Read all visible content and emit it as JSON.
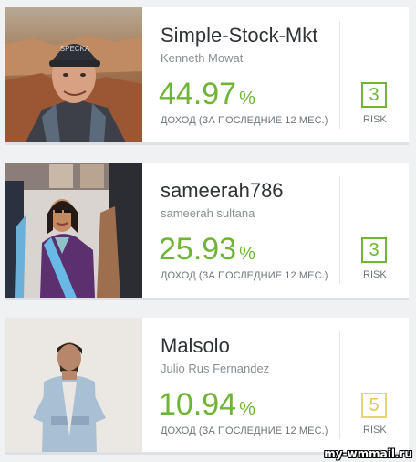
{
  "traders": [
    {
      "username": "Simple-Stock-Mkt",
      "full_name": "Kenneth Mowat",
      "gain_value": "44.97",
      "gain_unit": "%",
      "gain_label": "ДОХОД (ЗА ПОСЛЕДНИЕ 12 МЕС.)",
      "risk_score": "3",
      "risk_label": "RISK",
      "risk_color": "#6fb535"
    },
    {
      "username": "sameerah786",
      "full_name": "sameerah sultana",
      "gain_value": "25.93",
      "gain_unit": "%",
      "gain_label": "ДОХОД (ЗА ПОСЛЕДНИЕ 12 МЕС.)",
      "risk_score": "3",
      "risk_label": "RISK",
      "risk_color": "#6fb535"
    },
    {
      "username": "Malsolo",
      "full_name": "Julio Rus Fernandez",
      "gain_value": "10.94",
      "gain_unit": "%",
      "gain_label": "ДОХОД (ЗА ПОСЛЕДНИЕ 12 МЕС.)",
      "risk_score": "5",
      "risk_label": "RISK",
      "risk_color": "#e5d86a"
    }
  ],
  "colors": {
    "gain": "#6fb535",
    "page_background": "#eff1f3"
  },
  "watermark": "my-wmmail.ru"
}
